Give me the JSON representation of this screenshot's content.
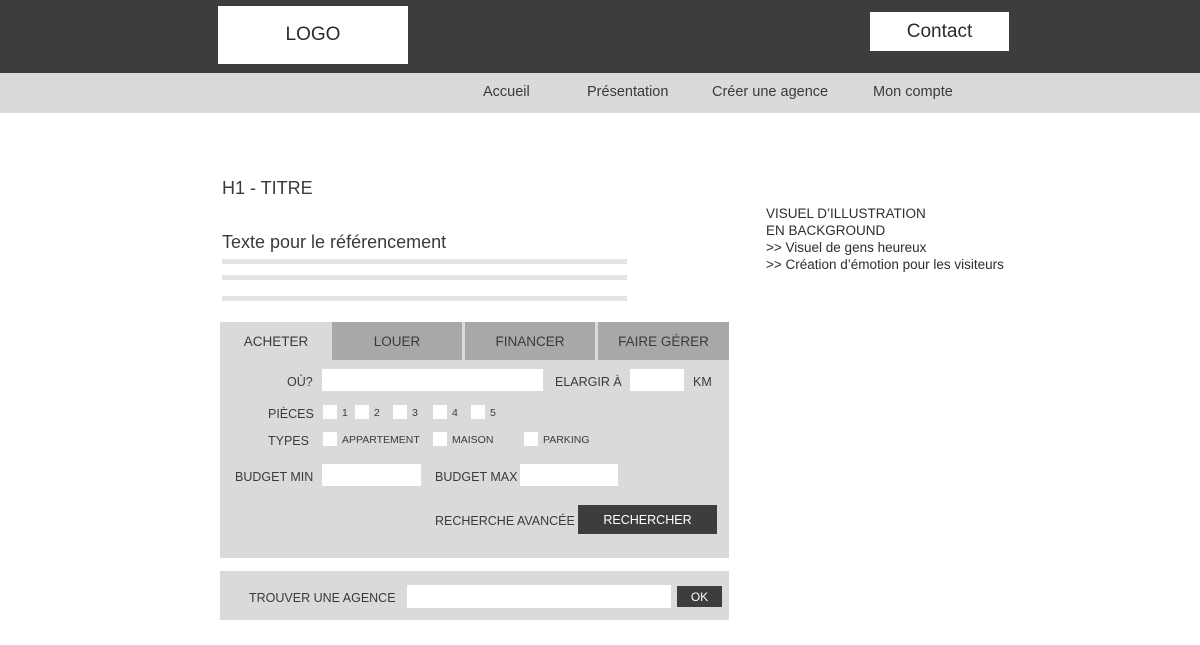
{
  "header": {
    "logo": "LOGO",
    "contact_label": "Contact"
  },
  "nav": {
    "items": [
      "Accueil",
      "Présentation",
      "Créer une agence",
      "Mon compte"
    ]
  },
  "content": {
    "h1": "H1 - TITRE",
    "seo_title": "Texte pour le référencement"
  },
  "visual": {
    "lines": [
      "VISUEL D’ILLUSTRATION",
      "EN BACKGROUND",
      ">> Visuel de gens heureux",
      ">> Création d’émotion pour les visiteurs"
    ]
  },
  "search": {
    "tabs": [
      "ACHETER",
      "LOUER",
      "FINANCER",
      "FAIRE GÉRER"
    ],
    "active_tab": "ACHETER",
    "where_label": "OÙ?",
    "where_value": "",
    "widen_label": "ELARGIR À",
    "widen_value": "",
    "km_label": "KM",
    "rooms_label": "PIÈCES",
    "rooms": [
      "1",
      "2",
      "3",
      "4",
      "5"
    ],
    "types_label": "TYPES",
    "types": [
      "APPARTEMENT",
      "MAISON",
      "PARKING"
    ],
    "budget_min_label": "BUDGET MIN",
    "budget_min_value": "",
    "budget_max_label": "BUDGET MAX",
    "budget_max_value": "",
    "advanced_label": "RECHERCHE AVANCÉE",
    "search_button": "RECHERCHER"
  },
  "agency": {
    "label": "TROUVER UNE AGENCE",
    "value": "",
    "ok_button": "OK"
  },
  "colors": {
    "topbar": "#3d3d3d",
    "navbar": "#dadada",
    "panel": "#dadada",
    "inactive_tab": "#a8a8a8",
    "button_dark": "#3d3d3d"
  }
}
